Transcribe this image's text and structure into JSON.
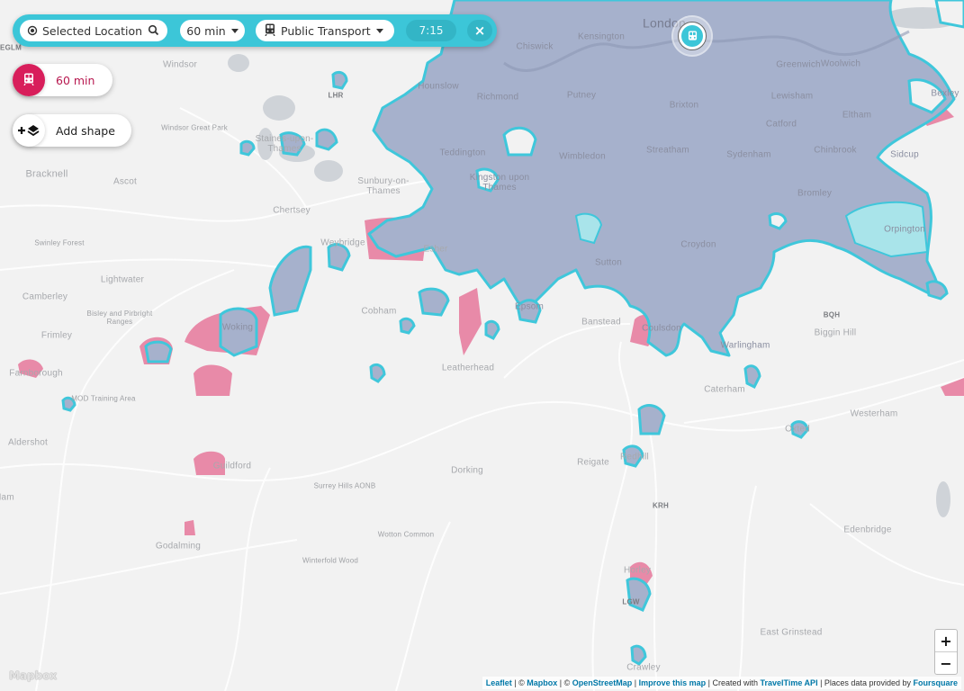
{
  "toolbar": {
    "location_label": "Selected Location",
    "duration_label": "60 min",
    "mode_label": "Public Transport",
    "time_label": "7:15",
    "close_label": "×",
    "icons": {
      "location": "target-icon",
      "search": "search-icon",
      "duration_caret": "caret-down-icon",
      "mode": "train-icon",
      "close": "close-icon"
    }
  },
  "sidebar": {
    "isochrone_chip": {
      "label": "60 min",
      "icon": "train-icon",
      "color": "#d81e5b"
    },
    "add_shape_chip": {
      "label": "Add shape",
      "icon": "add-layers-icon"
    }
  },
  "map": {
    "colors": {
      "reachable_fill": "#a6b1cc",
      "reachable_outline": "#3fc7db",
      "partial_fill": "#a9e4ea",
      "pink_area": "#e88aa8",
      "land": "#f2f2f2",
      "water": "#cdd1d6"
    },
    "marker": {
      "icon": "train-icon"
    },
    "places": [
      {
        "name": "London",
        "cls": "city"
      },
      {
        "name": "Kensington",
        "cls": "dark"
      },
      {
        "name": "Chiswick",
        "cls": "dark"
      },
      {
        "name": "Greenwich",
        "cls": "dark"
      },
      {
        "name": "Woolwich",
        "cls": "dark"
      },
      {
        "name": "Richmond",
        "cls": "dark"
      },
      {
        "name": "Putney",
        "cls": "dark"
      },
      {
        "name": "Brixton",
        "cls": "dark"
      },
      {
        "name": "Lewisham",
        "cls": "dark"
      },
      {
        "name": "Bexley",
        "cls": "dark"
      },
      {
        "name": "Eltham",
        "cls": "dark"
      },
      {
        "name": "Catford",
        "cls": "dark"
      },
      {
        "name": "Wimbledon",
        "cls": "dark"
      },
      {
        "name": "Streatham",
        "cls": "dark"
      },
      {
        "name": "Sydenham",
        "cls": "dark"
      },
      {
        "name": "Chinbrook",
        "cls": "dark"
      },
      {
        "name": "Sidcup",
        "cls": "dark"
      },
      {
        "name": "Teddington",
        "cls": "dark"
      },
      {
        "name": "Kingston upon Thames",
        "cls": "dark"
      },
      {
        "name": "Bromley",
        "cls": "dark"
      },
      {
        "name": "Orpington",
        "cls": "dark"
      },
      {
        "name": "Croydon",
        "cls": "dark"
      },
      {
        "name": "Sutton",
        "cls": "dark"
      },
      {
        "name": "Epsom",
        "cls": "dark"
      },
      {
        "name": "Coulsdon",
        "cls": "dark"
      },
      {
        "name": "Warlingham",
        "cls": "dark"
      },
      {
        "name": "Hounslow",
        "cls": "dark"
      },
      {
        "name": "Windsor",
        "cls": ""
      },
      {
        "name": "EGLM",
        "cls": "airport"
      },
      {
        "name": "LHR",
        "cls": "airport"
      },
      {
        "name": "Windsor Great Park",
        "cls": "sm"
      },
      {
        "name": "Staines-upon-Thames",
        "cls": ""
      },
      {
        "name": "Bracknell",
        "cls": "lg"
      },
      {
        "name": "Ascot",
        "cls": ""
      },
      {
        "name": "Sunbury-on-Thames",
        "cls": ""
      },
      {
        "name": "Chertsey",
        "cls": ""
      },
      {
        "name": "Weybridge",
        "cls": ""
      },
      {
        "name": "Esher",
        "cls": ""
      },
      {
        "name": "Swinley Forest",
        "cls": "sm"
      },
      {
        "name": "Lightwater",
        "cls": ""
      },
      {
        "name": "Camberley",
        "cls": ""
      },
      {
        "name": "Bisley and Pirbright Ranges",
        "cls": "sm"
      },
      {
        "name": "Frimley",
        "cls": ""
      },
      {
        "name": "Woking",
        "cls": "dark"
      },
      {
        "name": "Cobham",
        "cls": ""
      },
      {
        "name": "Banstead",
        "cls": ""
      },
      {
        "name": "BQH",
        "cls": "airport"
      },
      {
        "name": "Biggin Hill",
        "cls": ""
      },
      {
        "name": "Farnborough",
        "cls": ""
      },
      {
        "name": "MOD Training Area",
        "cls": "sm"
      },
      {
        "name": "Leatherhead",
        "cls": ""
      },
      {
        "name": "Caterham",
        "cls": ""
      },
      {
        "name": "Westerham",
        "cls": ""
      },
      {
        "name": "Oxted",
        "cls": ""
      },
      {
        "name": "Aldershot",
        "cls": ""
      },
      {
        "name": "Guildford",
        "cls": ""
      },
      {
        "name": "Reigate",
        "cls": ""
      },
      {
        "name": "Redhill",
        "cls": ""
      },
      {
        "name": "Dorking",
        "cls": ""
      },
      {
        "name": "Surrey Hills AONB",
        "cls": "sm"
      },
      {
        "name": "KRH",
        "cls": "airport"
      },
      {
        "name": "Edenbridge",
        "cls": ""
      },
      {
        "name": "Godalming",
        "cls": ""
      },
      {
        "name": "Wotton Common",
        "cls": "sm"
      },
      {
        "name": "Winterfold Wood",
        "cls": "sm"
      },
      {
        "name": "Horley",
        "cls": ""
      },
      {
        "name": "LGW",
        "cls": "airport"
      },
      {
        "name": "East Grinstead",
        "cls": ""
      },
      {
        "name": "Crawley",
        "cls": ""
      },
      {
        "name": "Ham",
        "cls": ""
      }
    ]
  },
  "controls": {
    "zoom_in": "+",
    "zoom_out": "−"
  },
  "branding": {
    "logo": "Mapbox"
  },
  "attribution": {
    "leaflet": "Leaflet",
    "sep1": " | © ",
    "mapbox": "Mapbox",
    "sep2": " | © ",
    "osm": "OpenStreetMap",
    "sep3": " | ",
    "improve": "Improve this map",
    "created": " | Created with ",
    "traveltime": "TravelTime API",
    "places": " | Places data provided by ",
    "foursquare": "Foursquare"
  }
}
